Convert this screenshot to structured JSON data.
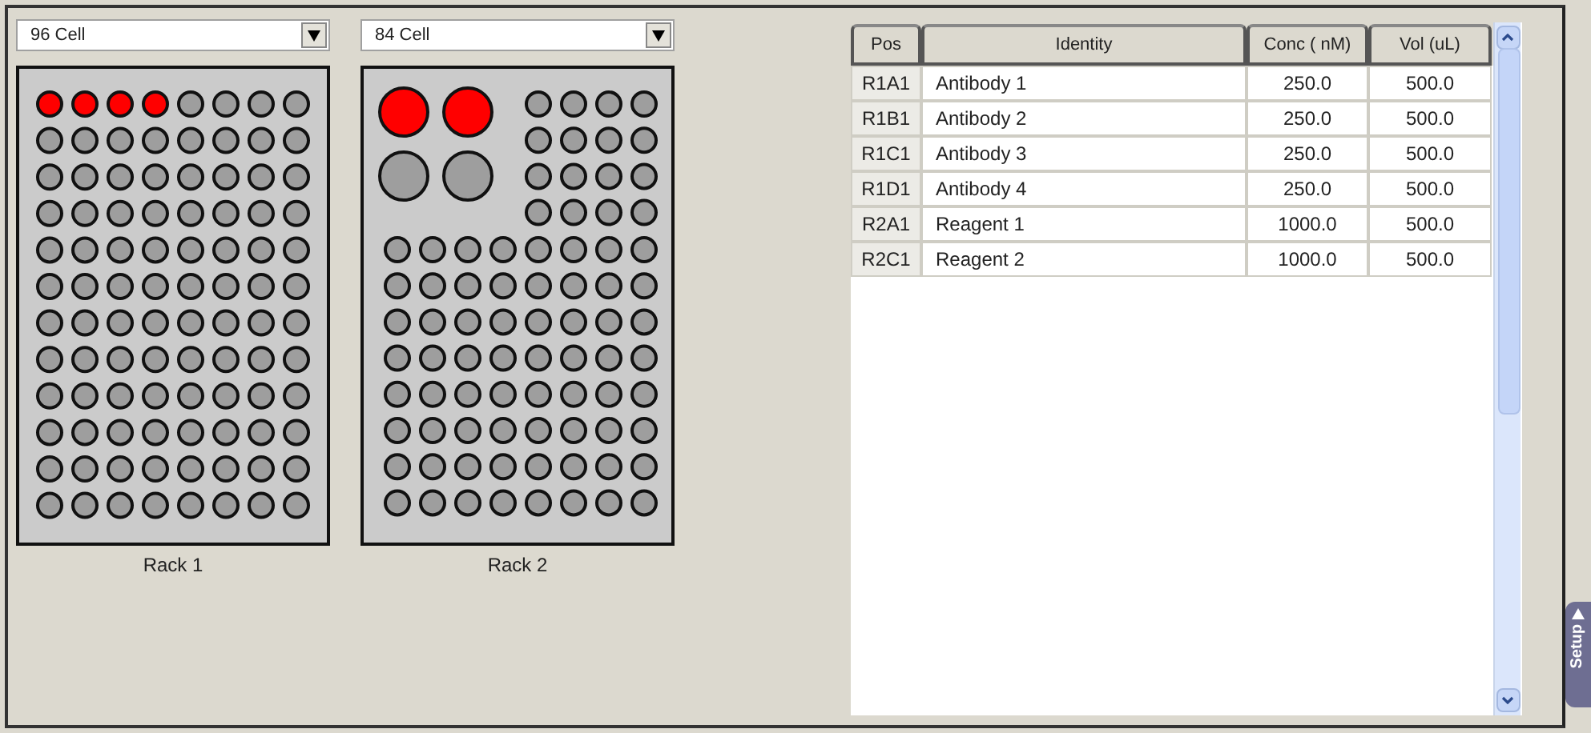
{
  "racks": [
    {
      "kind": "uniform",
      "dropdown": "96 Cell",
      "label": "Rack 1",
      "wells": [
        {
          "filled": true
        },
        {
          "filled": true
        },
        {
          "filled": true
        },
        {
          "filled": true
        },
        {
          "filled": false
        },
        {
          "filled": false
        },
        {
          "filled": false
        },
        {
          "filled": false
        },
        {
          "filled": false
        },
        {
          "filled": false
        },
        {
          "filled": false
        },
        {
          "filled": false
        },
        {
          "filled": false
        },
        {
          "filled": false
        },
        {
          "filled": false
        },
        {
          "filled": false
        },
        {
          "filled": false
        },
        {
          "filled": false
        },
        {
          "filled": false
        },
        {
          "filled": false
        },
        {
          "filled": false
        },
        {
          "filled": false
        },
        {
          "filled": false
        },
        {
          "filled": false
        },
        {
          "filled": false
        },
        {
          "filled": false
        },
        {
          "filled": false
        },
        {
          "filled": false
        },
        {
          "filled": false
        },
        {
          "filled": false
        },
        {
          "filled": false
        },
        {
          "filled": false
        },
        {
          "filled": false
        },
        {
          "filled": false
        },
        {
          "filled": false
        },
        {
          "filled": false
        },
        {
          "filled": false
        },
        {
          "filled": false
        },
        {
          "filled": false
        },
        {
          "filled": false
        },
        {
          "filled": false
        },
        {
          "filled": false
        },
        {
          "filled": false
        },
        {
          "filled": false
        },
        {
          "filled": false
        },
        {
          "filled": false
        },
        {
          "filled": false
        },
        {
          "filled": false
        },
        {
          "filled": false
        },
        {
          "filled": false
        },
        {
          "filled": false
        },
        {
          "filled": false
        },
        {
          "filled": false
        },
        {
          "filled": false
        },
        {
          "filled": false
        },
        {
          "filled": false
        },
        {
          "filled": false
        },
        {
          "filled": false
        },
        {
          "filled": false
        },
        {
          "filled": false
        },
        {
          "filled": false
        },
        {
          "filled": false
        },
        {
          "filled": false
        },
        {
          "filled": false
        },
        {
          "filled": false
        },
        {
          "filled": false
        },
        {
          "filled": false
        },
        {
          "filled": false
        },
        {
          "filled": false
        },
        {
          "filled": false
        },
        {
          "filled": false
        },
        {
          "filled": false
        },
        {
          "filled": false
        },
        {
          "filled": false
        },
        {
          "filled": false
        },
        {
          "filled": false
        },
        {
          "filled": false
        },
        {
          "filled": false
        },
        {
          "filled": false
        },
        {
          "filled": false
        },
        {
          "filled": false
        },
        {
          "filled": false
        },
        {
          "filled": false
        },
        {
          "filled": false
        },
        {
          "filled": false
        },
        {
          "filled": false
        },
        {
          "filled": false
        },
        {
          "filled": false
        },
        {
          "filled": false
        },
        {
          "filled": false
        },
        {
          "filled": false
        },
        {
          "filled": false
        },
        {
          "filled": false
        },
        {
          "filled": false
        },
        {
          "filled": false
        },
        {
          "filled": false
        }
      ]
    },
    {
      "kind": "mixed",
      "dropdown": "84 Cell",
      "label": "Rack 2",
      "wells": [
        {
          "filled": true
        },
        {
          "filled": true
        },
        {
          "filled": false
        },
        {
          "filled": false
        },
        {
          "filled": false
        },
        {
          "filled": false
        },
        {
          "filled": false
        },
        {
          "filled": false
        },
        {
          "filled": false
        },
        {
          "filled": false
        },
        {
          "filled": false
        },
        {
          "filled": false
        },
        {
          "filled": false
        },
        {
          "filled": false
        },
        {
          "filled": false
        },
        {
          "filled": false
        },
        {
          "filled": false
        },
        {
          "filled": false
        },
        {
          "filled": false
        },
        {
          "filled": false
        },
        {
          "filled": false
        },
        {
          "filled": false
        },
        {
          "filled": false
        },
        {
          "filled": false
        },
        {
          "filled": false
        },
        {
          "filled": false
        },
        {
          "filled": false
        },
        {
          "filled": false
        },
        {
          "filled": false
        },
        {
          "filled": false
        },
        {
          "filled": false
        },
        {
          "filled": false
        },
        {
          "filled": false
        },
        {
          "filled": false
        },
        {
          "filled": false
        },
        {
          "filled": false
        },
        {
          "filled": false
        },
        {
          "filled": false
        },
        {
          "filled": false
        },
        {
          "filled": false
        },
        {
          "filled": false
        },
        {
          "filled": false
        },
        {
          "filled": false
        },
        {
          "filled": false
        },
        {
          "filled": false
        },
        {
          "filled": false
        },
        {
          "filled": false
        },
        {
          "filled": false
        },
        {
          "filled": false
        },
        {
          "filled": false
        },
        {
          "filled": false
        },
        {
          "filled": false
        },
        {
          "filled": false
        },
        {
          "filled": false
        },
        {
          "filled": false
        },
        {
          "filled": false
        },
        {
          "filled": false
        },
        {
          "filled": false
        },
        {
          "filled": false
        },
        {
          "filled": false
        },
        {
          "filled": false
        },
        {
          "filled": false
        },
        {
          "filled": false
        },
        {
          "filled": false
        },
        {
          "filled": false
        },
        {
          "filled": false
        },
        {
          "filled": false
        },
        {
          "filled": false
        },
        {
          "filled": false
        },
        {
          "filled": false
        },
        {
          "filled": false
        },
        {
          "filled": false
        },
        {
          "filled": false
        },
        {
          "filled": false
        },
        {
          "filled": false
        },
        {
          "filled": false
        },
        {
          "filled": false
        },
        {
          "filled": false
        },
        {
          "filled": false
        },
        {
          "filled": false
        },
        {
          "filled": false
        },
        {
          "filled": false
        },
        {
          "filled": false
        },
        {
          "filled": false
        }
      ]
    }
  ],
  "table": {
    "columns": [
      "Pos",
      "Identity",
      "Conc ( nM)",
      "Vol (uL)"
    ],
    "rows": [
      {
        "pos": "R1A1",
        "identity": "Antibody 1",
        "conc": "250.0",
        "vol": "500.0"
      },
      {
        "pos": "R1B1",
        "identity": "Antibody 2",
        "conc": "250.0",
        "vol": "500.0"
      },
      {
        "pos": "R1C1",
        "identity": "Antibody 3",
        "conc": "250.0",
        "vol": "500.0"
      },
      {
        "pos": "R1D1",
        "identity": "Antibody 4",
        "conc": "250.0",
        "vol": "500.0"
      },
      {
        "pos": "R2A1",
        "identity": "Reagent 1",
        "conc": "1000.0",
        "vol": "500.0"
      },
      {
        "pos": "R2C1",
        "identity": "Reagent 2",
        "conc": "1000.0",
        "vol": "500.0"
      }
    ]
  },
  "side_tab": {
    "label": "Setup"
  }
}
